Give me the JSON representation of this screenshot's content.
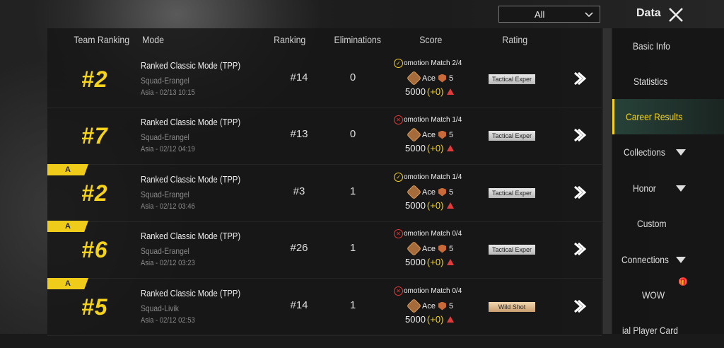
{
  "header": {
    "filter_value": "All",
    "title": "Data"
  },
  "columns": {
    "team_ranking": "Team Ranking",
    "mode": "Mode",
    "ranking": "Ranking",
    "eliminations": "Eliminations",
    "score": "Score",
    "rating": "Rating"
  },
  "rows": [
    {
      "badge": "",
      "team_rank": "#2",
      "mode": "Ranked Classic Mode (TPP)",
      "map": "Squad-Erangel",
      "date": "Asia - 02/13 10:15",
      "ranking": "#14",
      "eliminations": "0",
      "promo_status": "ok",
      "promo": "omotion Match 2/4",
      "tier_name": "Ace",
      "tier_level": "5",
      "score": "5000",
      "delta": "(+0)",
      "rating": "Tactical Exper",
      "rating_style": "silver"
    },
    {
      "badge": "",
      "team_rank": "#7",
      "mode": "Ranked Classic Mode (TPP)",
      "map": "Squad-Erangel",
      "date": "Asia - 02/12 04:19",
      "ranking": "#13",
      "eliminations": "0",
      "promo_status": "fail",
      "promo": "omotion Match 1/4",
      "tier_name": "Ace",
      "tier_level": "5",
      "score": "5000",
      "delta": "(+0)",
      "rating": "Tactical Exper",
      "rating_style": "silver"
    },
    {
      "badge": "A",
      "team_rank": "#2",
      "mode": "Ranked Classic Mode (TPP)",
      "map": "Squad-Erangel",
      "date": "Asia - 02/12 03:46",
      "ranking": "#3",
      "eliminations": "1",
      "promo_status": "ok",
      "promo": "omotion Match 1/4",
      "tier_name": "Ace",
      "tier_level": "5",
      "score": "5000",
      "delta": "(+0)",
      "rating": "Tactical Exper",
      "rating_style": "silver"
    },
    {
      "badge": "A",
      "team_rank": "#6",
      "mode": "Ranked Classic Mode (TPP)",
      "map": "Squad-Erangel",
      "date": "Asia - 02/12 03:23",
      "ranking": "#26",
      "eliminations": "1",
      "promo_status": "fail",
      "promo": "omotion Match 0/4",
      "tier_name": "Ace",
      "tier_level": "5",
      "score": "5000",
      "delta": "(+0)",
      "rating": "Tactical Exper",
      "rating_style": "silver"
    },
    {
      "badge": "A",
      "team_rank": "#5",
      "mode": "Ranked Classic Mode (TPP)",
      "map": "Squad-Livik",
      "date": "Asia - 02/12 02:53",
      "ranking": "#14",
      "eliminations": "1",
      "promo_status": "fail",
      "promo": "omotion Match 0/4",
      "tier_name": "Ace",
      "tier_level": "5",
      "score": "5000",
      "delta": "(+0)",
      "rating": "Wild Shot",
      "rating_style": "gold"
    }
  ],
  "sidebar": {
    "items": [
      {
        "label": "Basic Info",
        "dropdown": false,
        "active": false
      },
      {
        "label": "Statistics",
        "dropdown": false,
        "active": false
      },
      {
        "label": "Career Results",
        "dropdown": false,
        "active": true
      },
      {
        "label": "Collections",
        "dropdown": true,
        "active": false
      },
      {
        "label": "Honor",
        "dropdown": true,
        "active": false
      },
      {
        "label": "Custom",
        "dropdown": false,
        "active": false
      },
      {
        "label": "Connections",
        "dropdown": true,
        "active": false
      },
      {
        "label": "WOW",
        "dropdown": false,
        "active": false
      },
      {
        "label": "ial Player Card",
        "dropdown": false,
        "active": false
      }
    ]
  },
  "colors": {
    "accent": "#f5d21c",
    "danger": "#e23b3b"
  }
}
